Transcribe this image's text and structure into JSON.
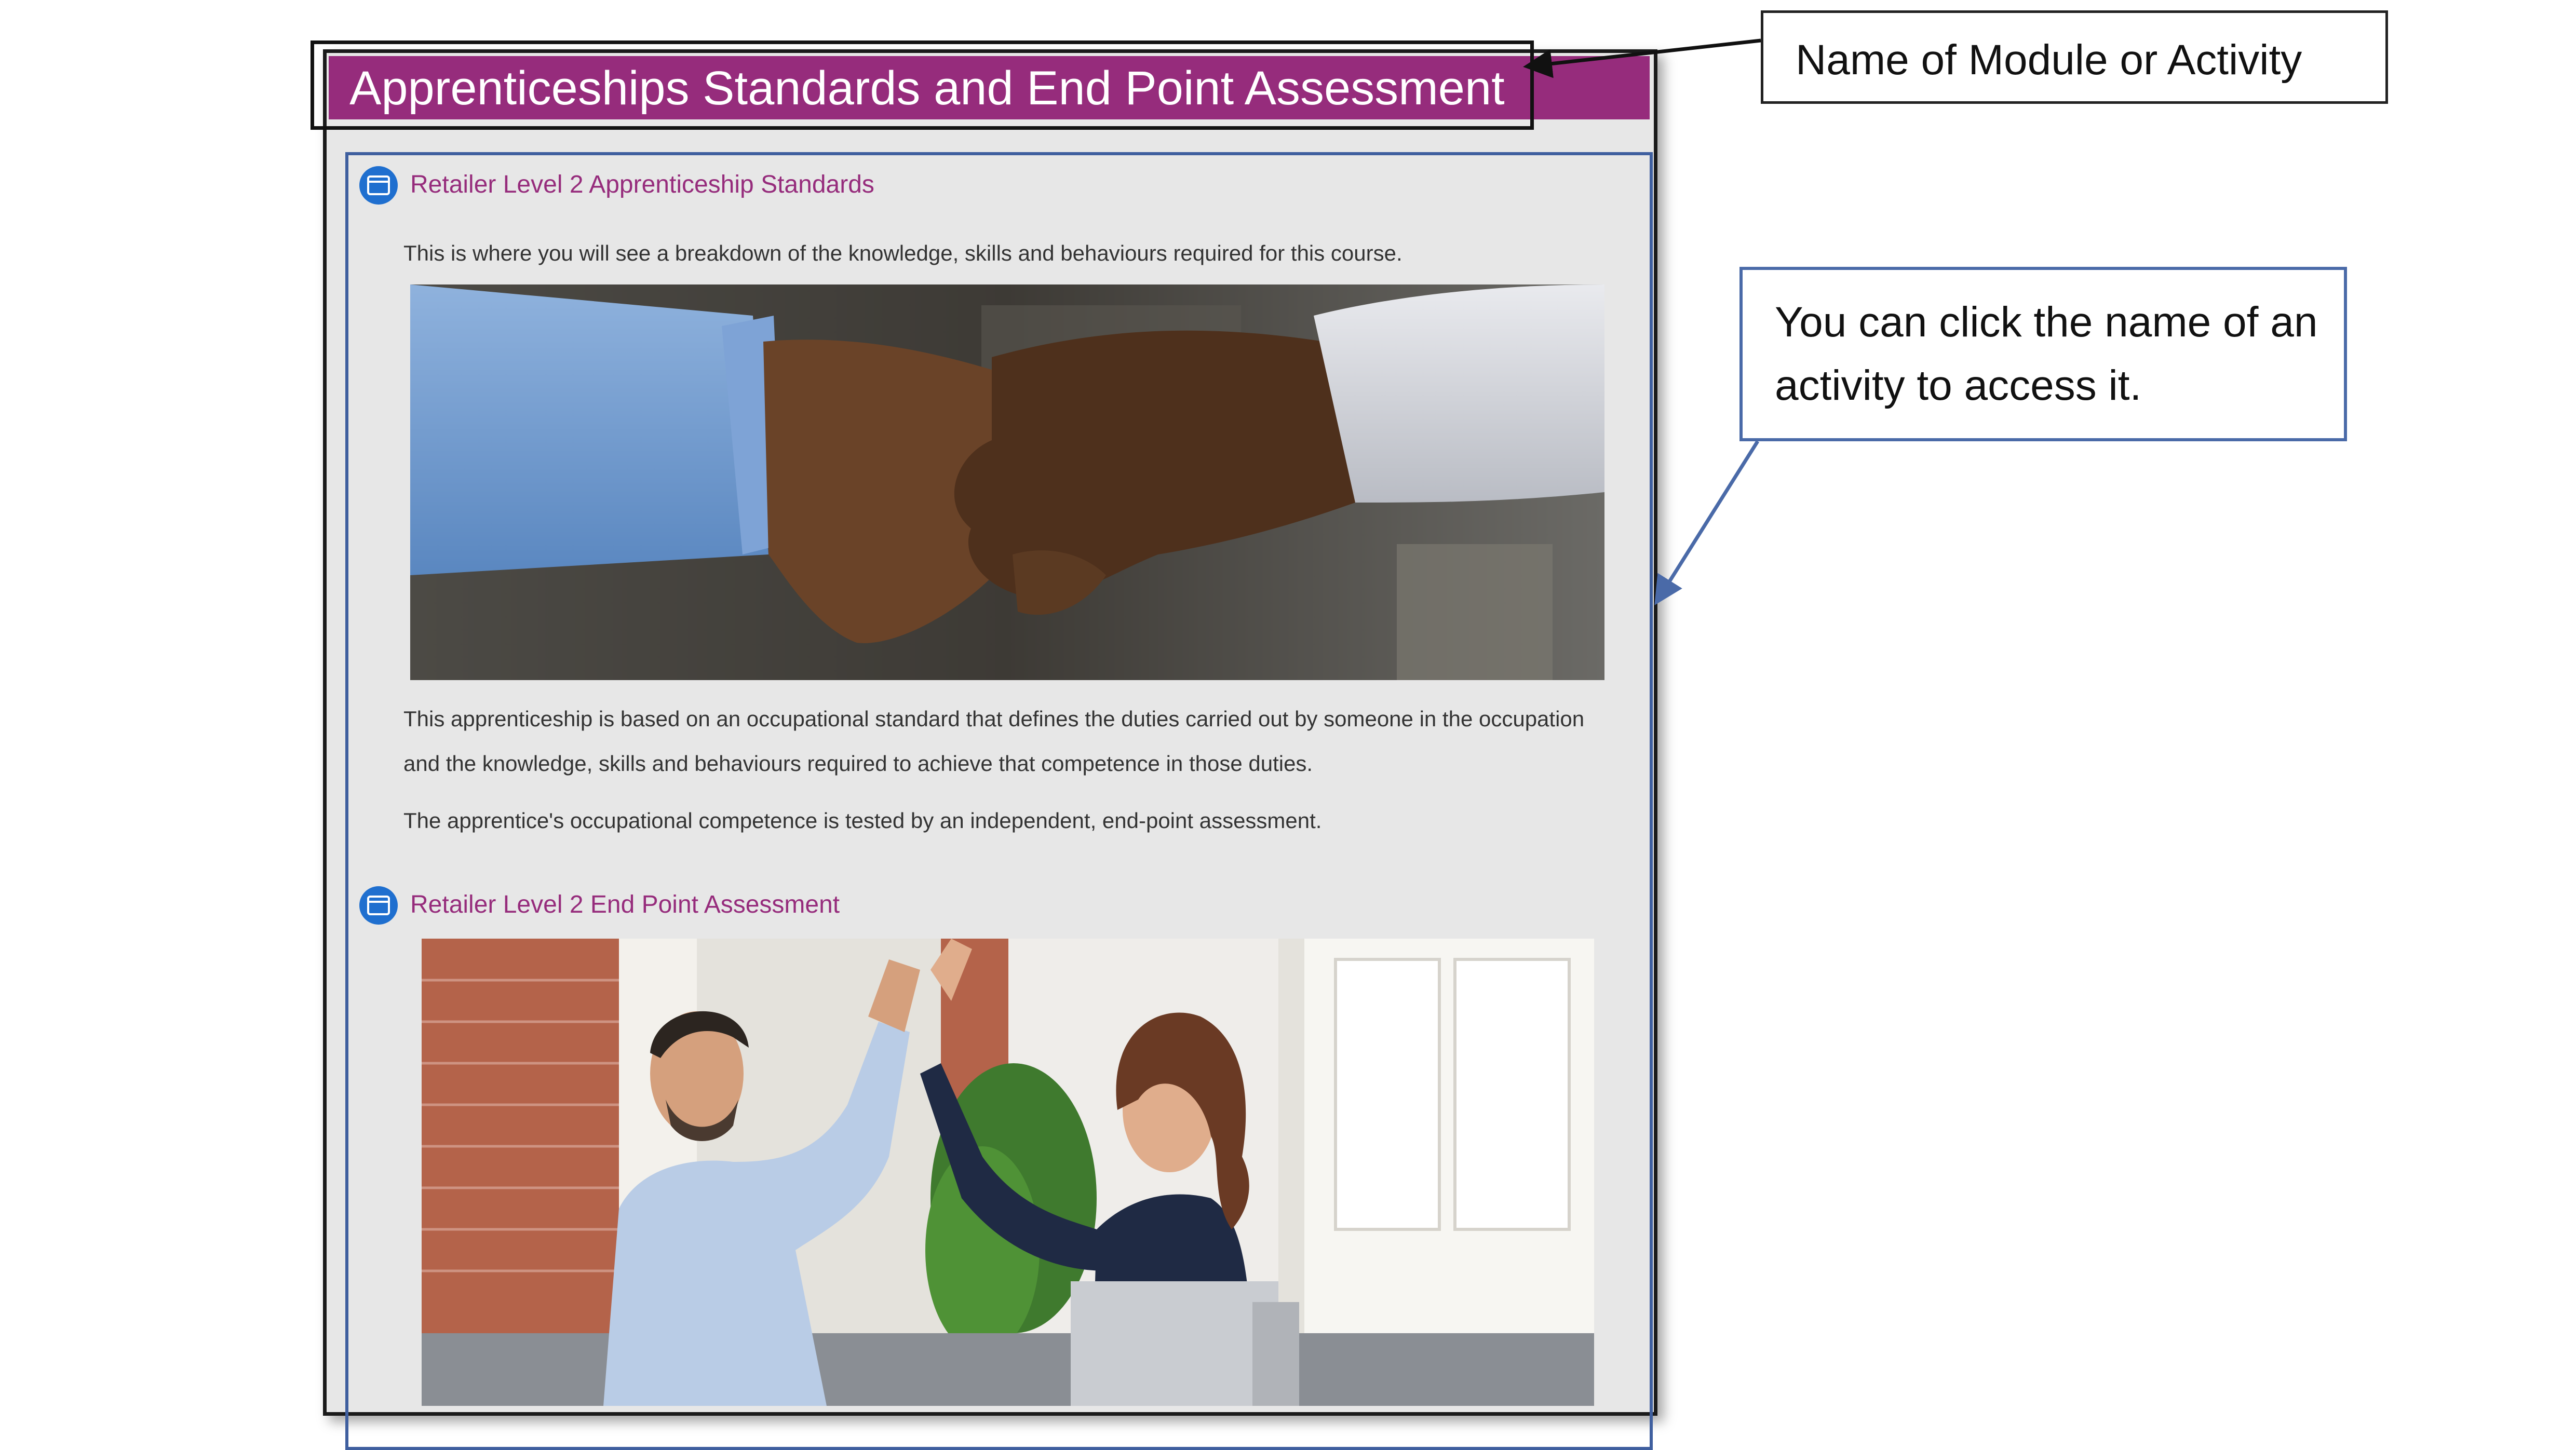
{
  "module": {
    "title": "Apprenticeships Standards and End Point Assessment",
    "accent_color": "#962c7c"
  },
  "activities": [
    {
      "name": "Retailer Level 2 Apprenticeship Standards",
      "icon": "page-icon",
      "intro": "This is where you will see a breakdown of the knowledge, skills and behaviours required for this course.",
      "image": "handshake-photo",
      "description": [
        "This apprenticeship is based on an occupational standard that defines the duties carried out by someone in the occupation and the knowledge, skills and behaviours required to achieve that competence in those duties.",
        "The apprentice's occupational competence is tested by an independent, end-point assessment."
      ]
    },
    {
      "name": "Retailer Level 2 End Point Assessment",
      "icon": "page-icon",
      "image": "high-five-photo"
    }
  ],
  "callouts": {
    "module_name": "Name of Module or Activity",
    "click_hint": "You can click the name of an activity to access it."
  },
  "colors": {
    "callout_blue": "#4a6aa8",
    "icon_blue": "#1f6fcf",
    "panel_bg": "#e7e7e7"
  }
}
